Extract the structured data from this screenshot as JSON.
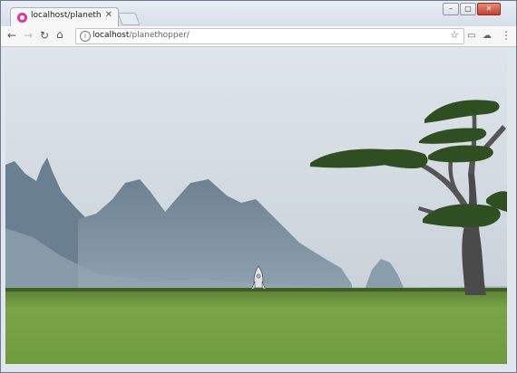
{
  "tab": {
    "title": "localhost/planethopper/",
    "close_icon": "close-icon",
    "favicon": "app-favicon"
  },
  "window_controls": {
    "minimize_icon": "minimize-icon",
    "maximize_icon": "maximize-icon",
    "close_icon": "close-icon"
  },
  "toolbar": {
    "back_icon": "arrow-left-icon",
    "forward_icon": "arrow-right-icon",
    "reload_icon": "reload-icon",
    "home_icon": "home-icon",
    "info_icon": "info-icon",
    "url_host": "localhost",
    "url_path": "/planethopper/",
    "bookmark_icon": "star-icon",
    "cast_icon": "cast-icon",
    "extension_icon": "extension-icon",
    "menu_icon": "more-vertical-icon"
  },
  "scene": {
    "sky_color": "#cfd8de",
    "mountain_color": "#6f8596",
    "ground_color": "#6f9b3f",
    "tree_trunk_color": "#4a4a4a",
    "tree_foliage_color": "#2f4f22",
    "rocket_color": "#d9d9d9"
  }
}
